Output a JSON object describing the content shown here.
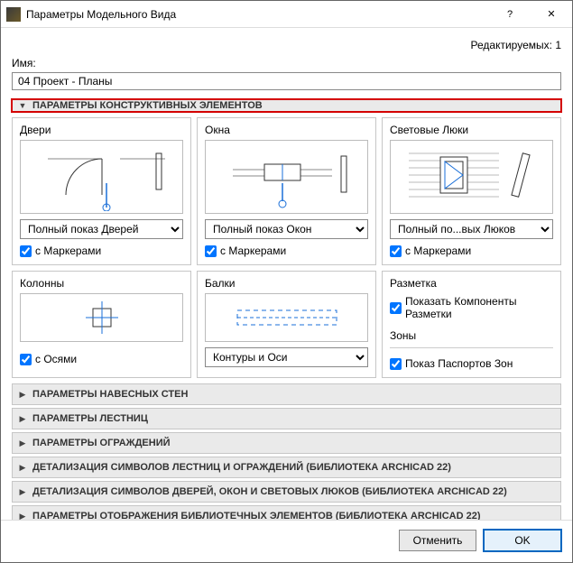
{
  "window": {
    "title": "Параметры Модельного Вида",
    "editable_label": "Редактируемых:",
    "editable_count": 1
  },
  "name": {
    "label": "Имя:",
    "value": "04 Проект - Планы"
  },
  "main_section": {
    "title": "ПАРАМЕТРЫ КОНСТРУКТИВНЫХ ЭЛЕМЕНТОВ"
  },
  "doors": {
    "title": "Двери",
    "combo": "Полный показ Дверей",
    "check": "с Маркерами"
  },
  "windows": {
    "title": "Окна",
    "combo": "Полный показ Окон",
    "check": "с Маркерами"
  },
  "skylights": {
    "title": "Световые Люки",
    "combo": "Полный по...вых Люков",
    "check": "с Маркерами"
  },
  "columns": {
    "title": "Колонны",
    "check": "с Осями"
  },
  "beams": {
    "title": "Балки",
    "combo": "Контуры и Оси"
  },
  "markup": {
    "title": "Разметка",
    "show_components": "Показать Компоненты Разметки"
  },
  "zones": {
    "title": "Зоны",
    "show_passports": "Показ Паспортов Зон"
  },
  "collapsed_sections": [
    "ПАРАМЕТРЫ НАВЕСНЫХ СТЕН",
    "ПАРАМЕТРЫ ЛЕСТНИЦ",
    "ПАРАМЕТРЫ ОГРАЖДЕНИЙ",
    "ДЕТАЛИЗАЦИЯ СИМВОЛОВ ЛЕСТНИЦ И ОГРАЖДЕНИЙ (БИБЛИОТЕКА ARCHICAD 22)",
    "ДЕТАЛИЗАЦИЯ СИМВОЛОВ ДВЕРЕЙ, ОКОН И СВЕТОВЫХ ЛЮКОВ (БИБЛИОТЕКА ARCHICAD 22)",
    "ПАРАМЕТРЫ ОТОБРАЖЕНИЯ БИБЛИОТЕЧНЫХ ЭЛЕМЕНТОВ (БИБЛИОТЕКА ARCHICAD 22)"
  ],
  "buttons": {
    "cancel": "Отменить",
    "ok": "OK"
  }
}
